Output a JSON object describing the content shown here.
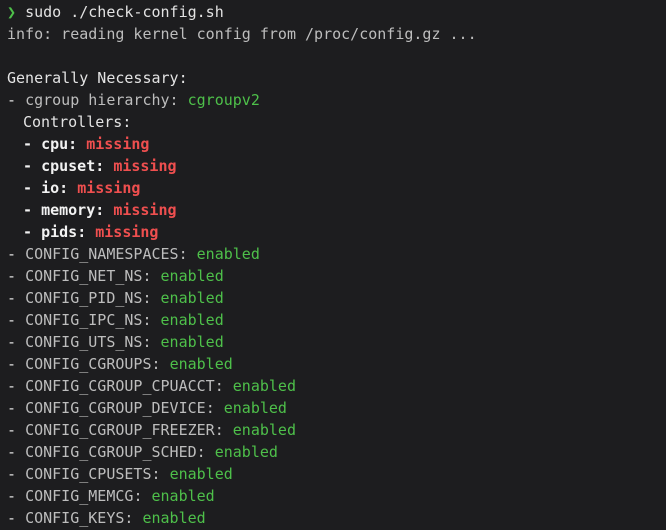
{
  "command": {
    "prompt_glyph": "❯",
    "text": "sudo ./check-config.sh"
  },
  "info_line": "info: reading kernel config from /proc/config.gz ...",
  "section_title": "Generally Necessary:",
  "cgroup": {
    "label": "cgroup hierarchy: ",
    "value": "cgroupv2",
    "controllers_label": "Controllers:",
    "controllers": [
      {
        "name": "cpu",
        "status": "missing"
      },
      {
        "name": "cpuset",
        "status": "missing"
      },
      {
        "name": "io",
        "status": "missing"
      },
      {
        "name": "memory",
        "status": "missing"
      },
      {
        "name": "pids",
        "status": "missing"
      }
    ]
  },
  "configs": [
    {
      "name": "CONFIG_NAMESPACES",
      "status": "enabled"
    },
    {
      "name": "CONFIG_NET_NS",
      "status": "enabled"
    },
    {
      "name": "CONFIG_PID_NS",
      "status": "enabled"
    },
    {
      "name": "CONFIG_IPC_NS",
      "status": "enabled"
    },
    {
      "name": "CONFIG_UTS_NS",
      "status": "enabled"
    },
    {
      "name": "CONFIG_CGROUPS",
      "status": "enabled"
    },
    {
      "name": "CONFIG_CGROUP_CPUACCT",
      "status": "enabled"
    },
    {
      "name": "CONFIG_CGROUP_DEVICE",
      "status": "enabled"
    },
    {
      "name": "CONFIG_CGROUP_FREEZER",
      "status": "enabled"
    },
    {
      "name": "CONFIG_CGROUP_SCHED",
      "status": "enabled"
    },
    {
      "name": "CONFIG_CPUSETS",
      "status": "enabled"
    },
    {
      "name": "CONFIG_MEMCG",
      "status": "enabled"
    },
    {
      "name": "CONFIG_KEYS",
      "status": "enabled"
    }
  ],
  "colors": {
    "background": "#1d1d1f",
    "text": "#e3e3e3",
    "enabled": "#4ec04a",
    "missing": "#ef4f4f"
  }
}
